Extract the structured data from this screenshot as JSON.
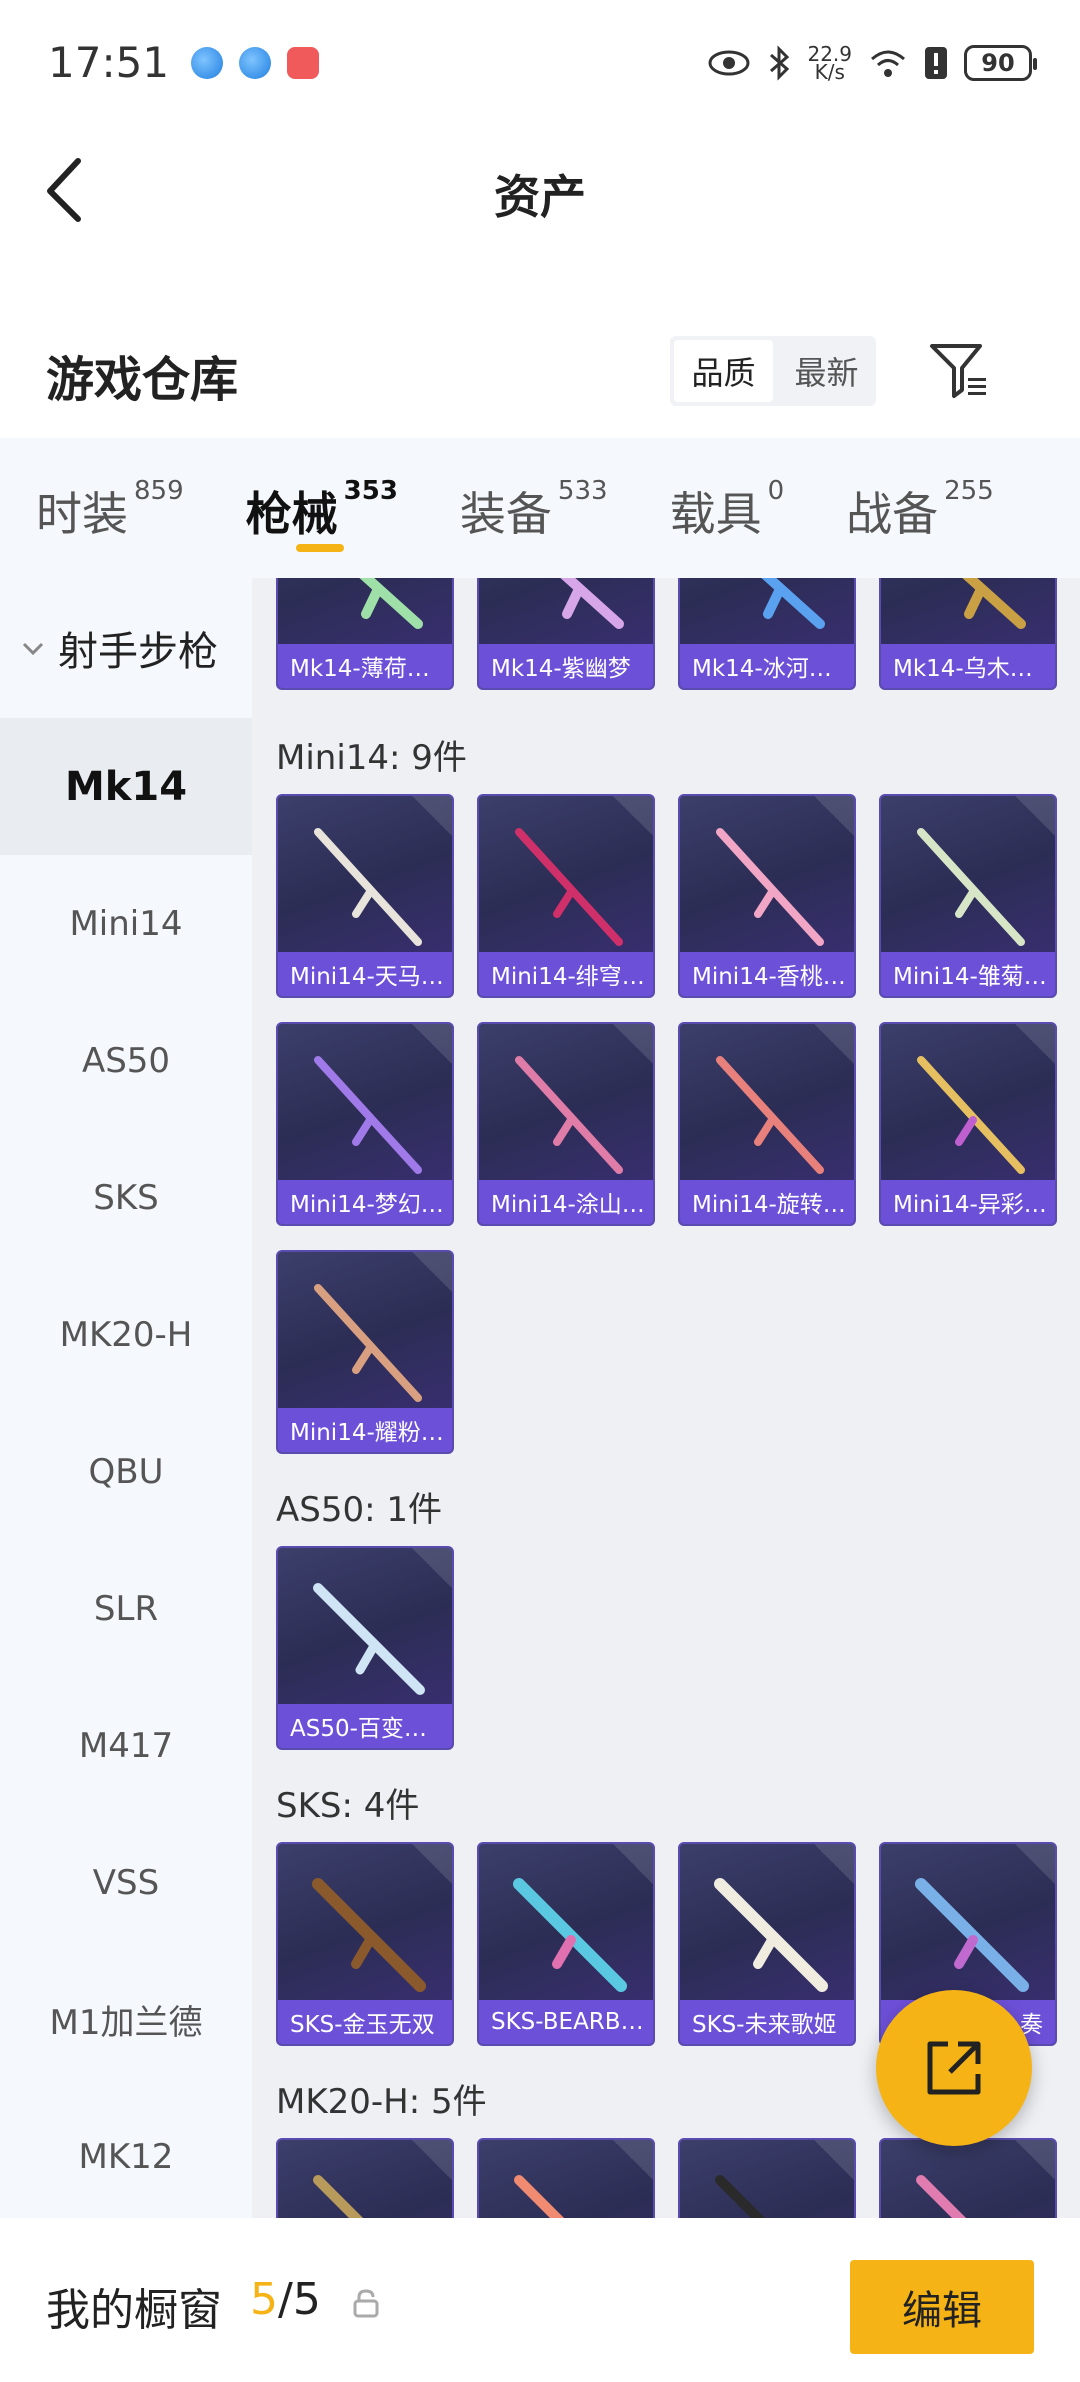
{
  "status_bar": {
    "time": "17:51",
    "speed_top": "22.9",
    "speed_bottom": "K/s",
    "battery": "90"
  },
  "header": {
    "title": "资产"
  },
  "warehouse": {
    "title": "游戏仓库",
    "sort_options": [
      "品质",
      "最新"
    ]
  },
  "tabs": [
    {
      "label": "时装",
      "count": "859"
    },
    {
      "label": "枪械",
      "count": "353"
    },
    {
      "label": "装备",
      "count": "533"
    },
    {
      "label": "载具",
      "count": "0"
    },
    {
      "label": "战备",
      "count": "255"
    }
  ],
  "sidebar": {
    "group": "射手步枪",
    "items": [
      "Mk14",
      "Mini14",
      "AS50",
      "SKS",
      "MK20-H",
      "QBU",
      "SLR",
      "M417",
      "VSS",
      "M1加兰德",
      "MK12"
    ]
  },
  "content": {
    "mk14_cards": [
      "Mk14-薄荷…",
      "Mk14-紫幽梦",
      "Mk14-冰河…",
      "Mk14-乌木…"
    ],
    "mini14_title": "Mini14: 9件",
    "mini14_cards": [
      "Mini14-天马…",
      "Mini14-绯穹…",
      "Mini14-香桃…",
      "Mini14-雏菊…",
      "Mini14-梦幻…",
      "Mini14-涂山…",
      "Mini14-旋转…",
      "Mini14-异彩…",
      "Mini14-耀粉…"
    ],
    "as50_title": "AS50: 1件",
    "as50_cards": [
      "AS50-百变…"
    ],
    "sks_title": "SKS: 4件",
    "sks_cards": [
      "SKS-金玉无双",
      "SKS-BEARB…",
      "SKS-未来歌姬",
      "…奏"
    ],
    "mk20_title": "MK20-H: 5件"
  },
  "bottom": {
    "showcase_label": "我的橱窗",
    "count_current": "5",
    "count_sep": "/5",
    "edit_label": "编辑"
  },
  "colors": {
    "accent": "#f5b316",
    "card_label": "#6d50d8"
  }
}
